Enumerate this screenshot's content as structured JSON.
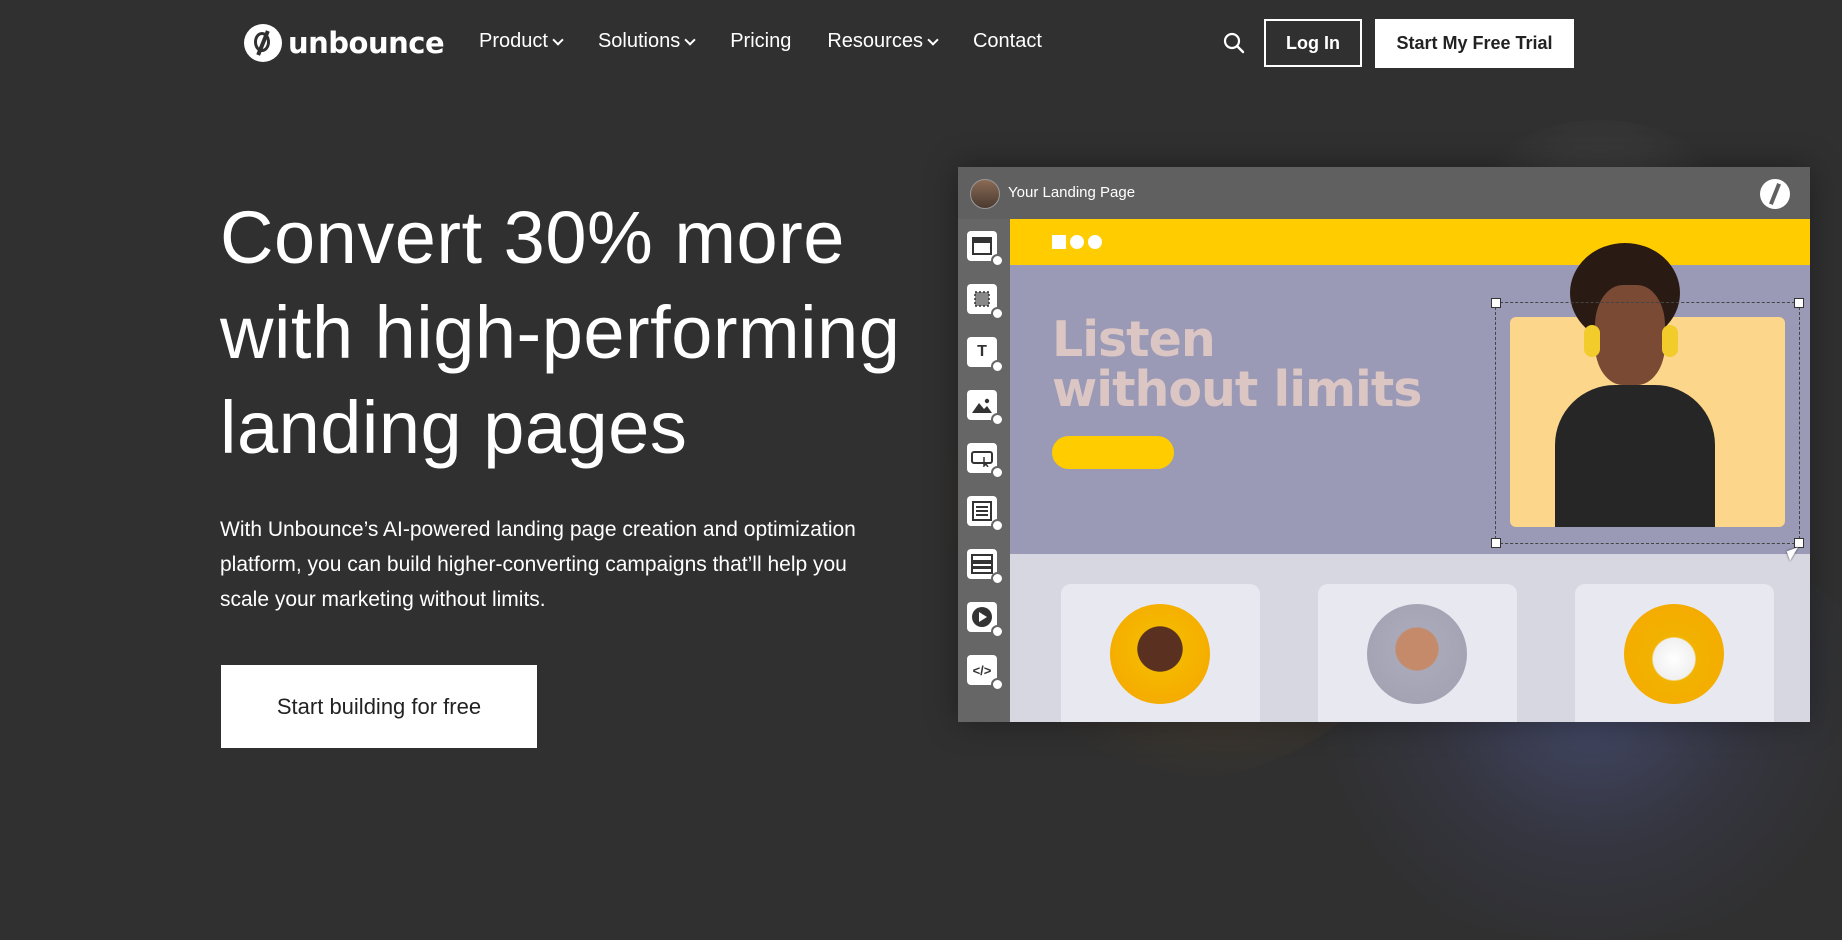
{
  "brand": {
    "name": "unbounce"
  },
  "nav": {
    "items": [
      {
        "label": "Product",
        "dropdown": true
      },
      {
        "label": "Solutions",
        "dropdown": true
      },
      {
        "label": "Pricing",
        "dropdown": false
      },
      {
        "label": "Resources",
        "dropdown": true
      },
      {
        "label": "Contact",
        "dropdown": false
      }
    ],
    "login_label": "Log In",
    "trial_label": "Start My Free Trial"
  },
  "hero": {
    "title": "Convert 30% more with high-performing landing pages",
    "subtitle": "With Unbounce’s AI-powered landing page creation and optimization platform, you can build higher-converting campaigns that’ll help you scale your marketing without limits.",
    "cta_label": "Start building for free"
  },
  "mockup": {
    "window_title": "Your Landing Page",
    "headline_line1": "Listen",
    "headline_line2": "without limits",
    "tools": [
      "section-icon",
      "box-icon",
      "text-icon",
      "image-icon",
      "button-icon",
      "form-icon",
      "list-icon",
      "video-icon",
      "code-icon"
    ]
  },
  "colors": {
    "background": "#303030",
    "accent_yellow": "#ffcc00",
    "mock_purple": "#9a99b6",
    "white": "#ffffff"
  }
}
